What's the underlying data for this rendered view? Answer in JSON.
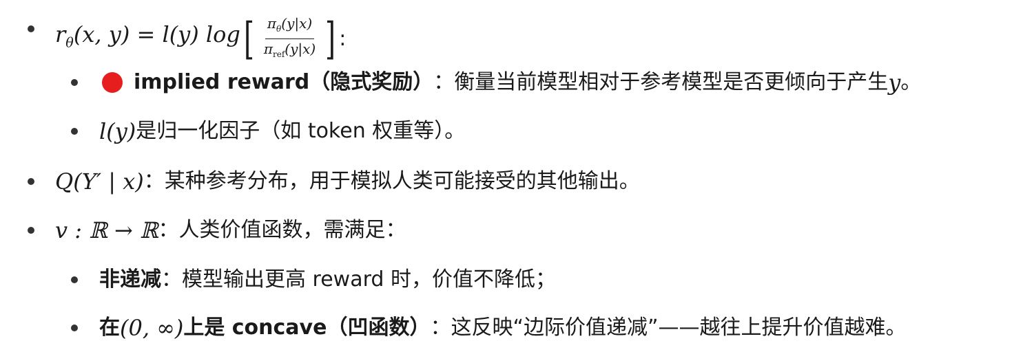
{
  "bullets": [
    {
      "level": 1,
      "formula_lhs": "r",
      "formula_lhs_sub": "θ",
      "formula_args": "(x, y) = l(y) log",
      "frac_num_main": "π",
      "frac_num_sub": "θ",
      "frac_num_tail": "(y|x)",
      "frac_den_main": "π",
      "frac_den_sub": "ref",
      "frac_den_tail": "(y|x)",
      "tail": ":"
    },
    {
      "level": 2,
      "bold_text": "implied reward（隐式奖励）",
      "text": "：衡量当前模型相对于参考模型是否更倾向于产生 ",
      "math_tail": "y",
      "end": "。"
    },
    {
      "level": 2,
      "math": "l(y)",
      "text": " 是归一化因子（如 token 权重等）。"
    },
    {
      "level": 1,
      "math": "Q(Y′ | x)",
      "text": "：某种参考分布，用于模拟人类可能接受的其他输出。"
    },
    {
      "level": 1,
      "math": "v : ℝ → ℝ",
      "text": "：人类价值函数，需满足："
    },
    {
      "level": 2,
      "bold_text": "非递减",
      "text": "：模型输出更高 reward 时，价值不降低；"
    },
    {
      "level": 2,
      "bold_pre": "在 ",
      "math": "(0, ∞)",
      "bold_post": " 上是 concave（凹函数）",
      "text": "：这反映“边际价值递减”——越往上提升价值越难。"
    }
  ],
  "colors": {
    "text": "#1a1a1a",
    "bullet": "#333333",
    "red_dot": "#e61e1e"
  },
  "icons": [
    "red-circle-icon"
  ]
}
